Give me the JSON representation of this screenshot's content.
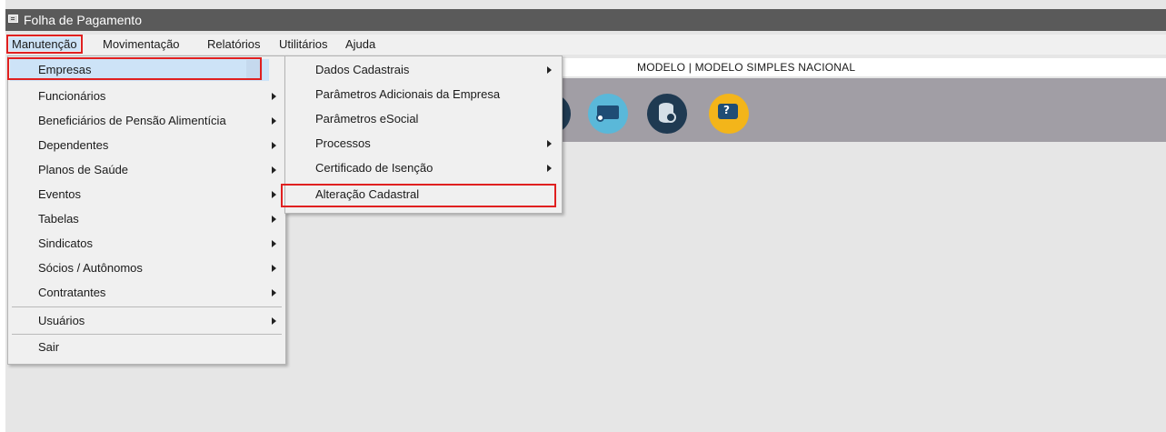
{
  "window": {
    "title": "Folha de Pagamento"
  },
  "menubar": {
    "items": [
      {
        "label": "Manutenção",
        "active": true
      },
      {
        "label": "Movimentação"
      },
      {
        "label": "Relatórios"
      },
      {
        "label": "Utilitários"
      },
      {
        "label": "Ajuda"
      }
    ]
  },
  "company_bar": {
    "text": "MODELO | MODELO SIMPLES NACIONAL"
  },
  "toolbar": {
    "buttons": [
      {
        "icon": "partial-dark-circle-icon",
        "color": "#1f3a52"
      },
      {
        "icon": "monitor-icon",
        "color": "#5ab8d9"
      },
      {
        "icon": "database-icon",
        "color": "#1f3a52"
      },
      {
        "icon": "help-chat-icon",
        "color": "#f3b51a"
      }
    ]
  },
  "main_menu": {
    "items": [
      {
        "label": "Empresas",
        "submenu": true,
        "highlighted": true
      },
      {
        "label": "Funcionários",
        "submenu": true
      },
      {
        "label": "Beneficiários de Pensão Alimentícia",
        "submenu": true
      },
      {
        "label": "Dependentes",
        "submenu": true
      },
      {
        "label": "Planos de Saúde",
        "submenu": true
      },
      {
        "label": "Eventos",
        "submenu": true
      },
      {
        "label": "Tabelas",
        "submenu": true
      },
      {
        "label": "Sindicatos",
        "submenu": true
      },
      {
        "label": "Sócios / Autônomos",
        "submenu": true
      },
      {
        "label": "Contratantes",
        "submenu": true
      },
      {
        "label": "Usuários",
        "submenu": true
      },
      {
        "label": "Sair",
        "submenu": false
      }
    ]
  },
  "empresas_submenu": {
    "items": [
      {
        "label": "Dados Cadastrais",
        "submenu": true
      },
      {
        "label": "Parâmetros Adicionais da Empresa",
        "submenu": false
      },
      {
        "label": "Parâmetros eSocial",
        "submenu": false
      },
      {
        "label": "Processos",
        "submenu": true
      },
      {
        "label": "Certificado de Isenção",
        "submenu": true
      },
      {
        "label": "Alteração Cadastral",
        "submenu": false,
        "highlighted": true
      }
    ]
  },
  "colors": {
    "titlebar": "#5a5a5a",
    "menu_bg": "#f0f0f0",
    "highlight": "#cde3f7",
    "annotation_red": "#e02020",
    "toolbar_bg": "#a19ea5"
  }
}
